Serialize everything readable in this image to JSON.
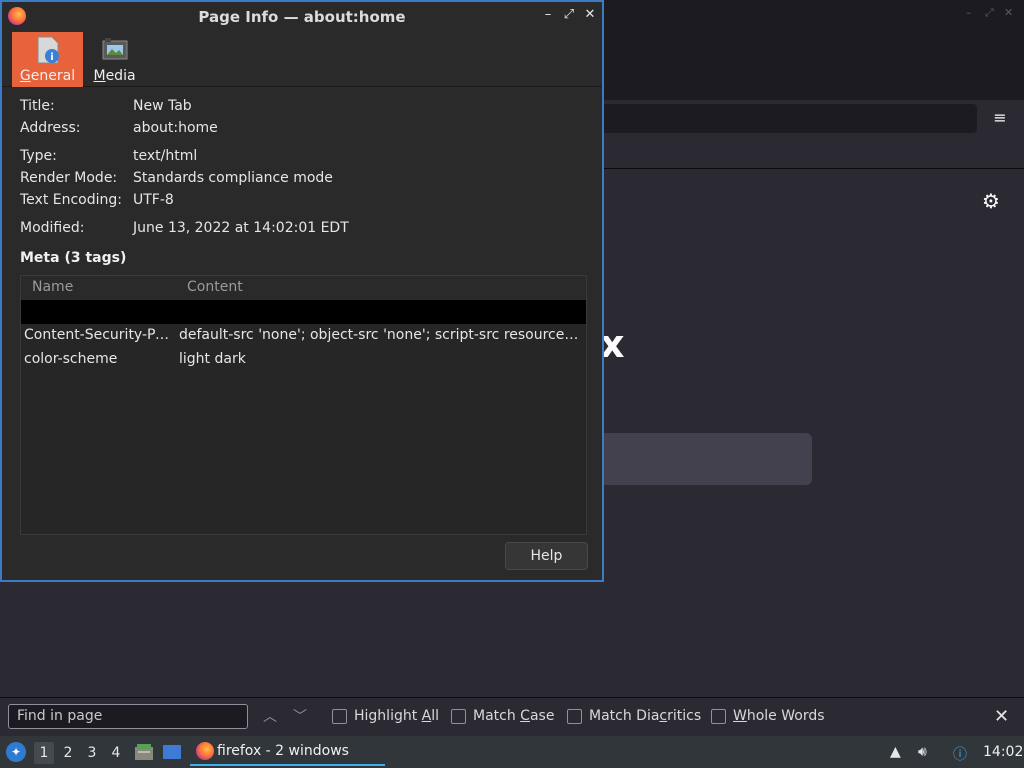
{
  "dialog": {
    "title": "Page Info — about:home",
    "tabs": [
      {
        "label": "General",
        "underline": "G",
        "rest": "eneral",
        "active": true
      },
      {
        "label": "Media",
        "underline": "M",
        "rest": "edia",
        "active": false
      }
    ],
    "fields": {
      "title_label": "Title:",
      "title_value": "New Tab",
      "address_label": "Address:",
      "address_value": "about:home",
      "type_label": "Type:",
      "type_value": "text/html",
      "render_label": "Render Mode:",
      "render_value": "Standards compliance mode",
      "encoding_label": "Text Encoding:",
      "encoding_value": "UTF-8",
      "modified_label": "Modified:",
      "modified_value": "June 13, 2022 at 14:02:01 EDT"
    },
    "meta_heading": "Meta (3 tags)",
    "meta_columns": {
      "name": "Name",
      "content": "Content"
    },
    "meta_rows": [
      {
        "name": "",
        "content": ""
      },
      {
        "name": "Content-Security-Pol...",
        "content": "default-src 'none'; object-src 'none'; script-src resource: c..."
      },
      {
        "name": "color-scheme",
        "content": "light dark"
      }
    ],
    "help_label": "Help"
  },
  "findbar": {
    "placeholder": "Find in page",
    "highlight_all": {
      "pre": "Highlight ",
      "u": "A",
      "post": "ll"
    },
    "match_case": {
      "pre": "Match ",
      "u": "C",
      "post": "ase"
    },
    "match_diacritics": {
      "pre": "Match Dia",
      "u": "c",
      "post": "ritics"
    },
    "whole_words": {
      "pre": "",
      "u": "W",
      "post": "hole Words"
    }
  },
  "taskbar": {
    "desktops": [
      "1",
      "2",
      "3",
      "4"
    ],
    "task_label": "firefox - 2 windows",
    "clock": "14:02"
  },
  "background": {
    "logo_fragment": "x"
  },
  "colors": {
    "accent": "#e8633b",
    "dialog_border": "#3d7bc4",
    "task_underline": "#3daee9"
  }
}
